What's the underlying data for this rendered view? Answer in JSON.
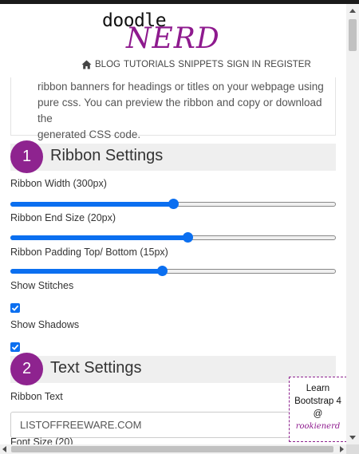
{
  "logo": {
    "line1": "doodle",
    "line2": "NERD"
  },
  "nav": {
    "items": [
      "BLOG",
      "TUTORIALS",
      "SNIPPETS",
      "SIGN IN",
      "REGISTER"
    ]
  },
  "intro": {
    "line1": "ribbon banners for headings or titles on your webpage using",
    "line2": "pure css. You can preview the ribbon and copy or download the",
    "line3": "generated CSS code."
  },
  "sections": [
    {
      "number": "1",
      "title": "Ribbon Settings"
    },
    {
      "number": "2",
      "title": "Text Settings"
    }
  ],
  "ribbon_settings": {
    "width": {
      "label": "Ribbon Width (300px)",
      "fraction": 0.5
    },
    "end_size": {
      "label": "Ribbon End Size (20px)",
      "fraction": 0.545
    },
    "padding": {
      "label": "Ribbon Padding Top/ Bottom (15px)",
      "fraction": 0.465
    },
    "show_stitches": {
      "label": "Show Stitches",
      "checked": true
    },
    "show_shadows": {
      "label": "Show Shadows",
      "checked": true
    }
  },
  "text_settings": {
    "ribbon_text_label": "Ribbon Text",
    "ribbon_text_value": "LISTOFFREEWARE.COM",
    "font_size_label": "Font Size (20)"
  },
  "promo": {
    "line1": "Learn",
    "line2": "Bootstrap 4",
    "line3": "@",
    "line4": "rookienerd"
  },
  "colors": {
    "accent": "#8e238f",
    "range": "#0b6ff0"
  }
}
